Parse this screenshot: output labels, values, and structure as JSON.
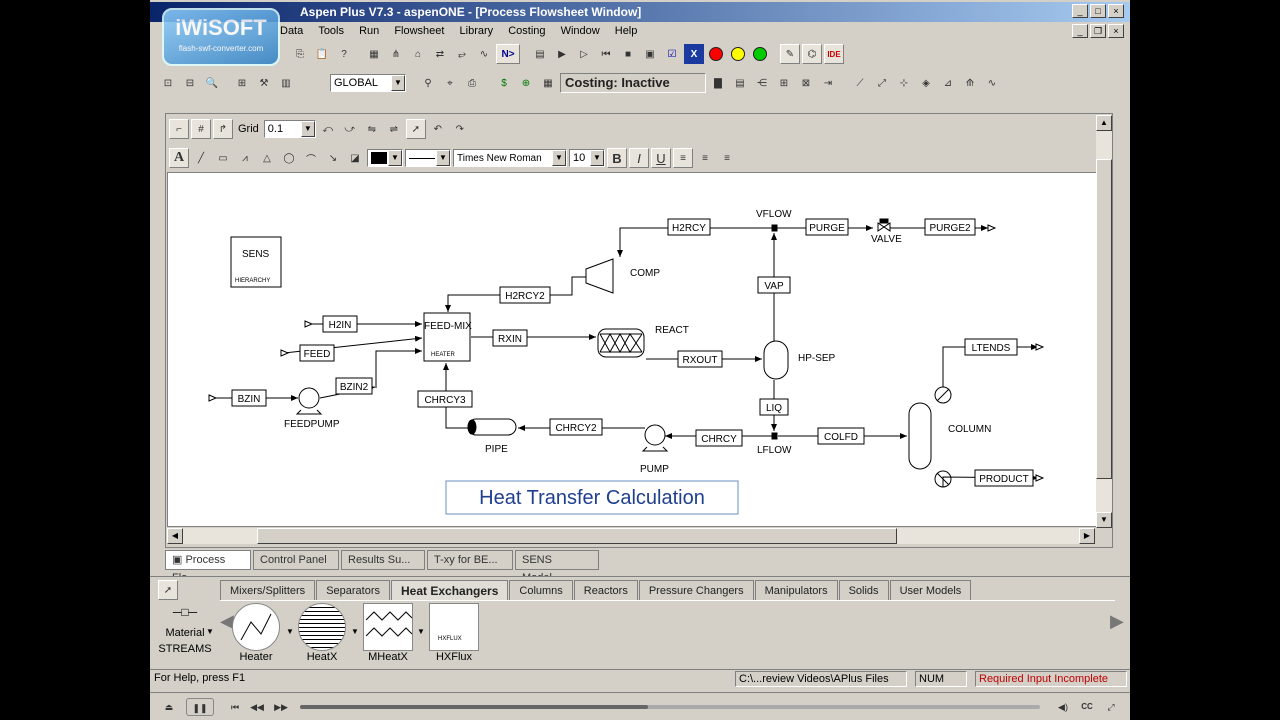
{
  "window": {
    "title": "Preview 04.bkp - Aspen Plus V7.3 - aspenONE - [Process Flowsheet Window]",
    "title_visible": "Aspen Plus V7.3 - aspenONE - [Process Flowsheet Window]"
  },
  "menu": [
    "Data",
    "Tools",
    "Run",
    "Flowsheet",
    "Library",
    "Costing",
    "Window",
    "Help"
  ],
  "toolbar": {
    "scope": "GLOBAL",
    "costing": "Costing: Inactive",
    "next_label": "N>"
  },
  "draw_toolbar": {
    "grid_label": "Grid",
    "grid_value": "0.1",
    "font": "Times New Roman",
    "font_size": "10"
  },
  "flowsheet": {
    "title_text": "Heat Transfer Calculation",
    "hierarchy": {
      "name": "SENS",
      "sub": "HIERARCHY"
    },
    "blocks": {
      "mixer": "FEED-MIX",
      "mixer_type": "HEATER",
      "comp": "COMP",
      "react": "REACT",
      "hpsep": "HP-SEP",
      "valve": "VALVE",
      "feedpump": "FEEDPUMP",
      "pipe": "PIPE",
      "pump": "PUMP",
      "column": "COLUMN",
      "vflow": "VFLOW",
      "lflow": "LFLOW"
    },
    "streams": {
      "h2rcy": "H2RCY",
      "purge": "PURGE",
      "purge2": "PURGE2",
      "h2rcy2": "H2RCY2",
      "vap": "VAP",
      "h2in": "H2IN",
      "feed": "FEED",
      "rxin": "RXIN",
      "rxout": "RXOUT",
      "bzin2": "BZIN2",
      "bzin": "BZIN",
      "chrcy3": "CHRCY3",
      "chrcy2": "CHRCY2",
      "chrcy": "CHRCY",
      "liq": "LIQ",
      "colfd": "COLFD",
      "ltends": "LTENDS",
      "product": "PRODUCT"
    }
  },
  "window_tabs": [
    "Process Flo...",
    "Control Panel",
    "Results Su...",
    "T-xy for BE...",
    "SENS Model..."
  ],
  "library": {
    "tabs": [
      "Mixers/Splitters",
      "Separators",
      "Heat Exchangers",
      "Columns",
      "Reactors",
      "Pressure Changers",
      "Manipulators",
      "Solids",
      "User Models"
    ],
    "active_tab": "Heat Exchangers",
    "stream_label": "Material",
    "streams_caption": "STREAMS",
    "models": [
      "Heater",
      "HeatX",
      "MHeatX",
      "HXFlux"
    ],
    "hxflux_icon_text": "HXFLUX"
  },
  "status": {
    "help": "For Help, press F1",
    "path": "C:\\...review Videos\\APlus Files",
    "num": "NUM",
    "state": "Required Input Incomplete",
    "state_color": "#c00000"
  },
  "watermark": {
    "brand": "iWiSOFT",
    "sub": "flash-swf-converter.com"
  },
  "player": {
    "progress": 0.47
  }
}
